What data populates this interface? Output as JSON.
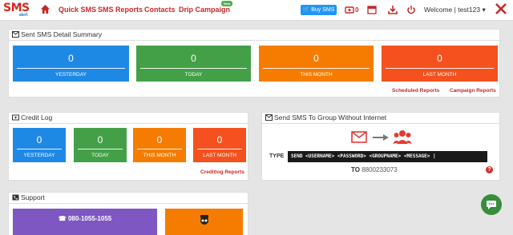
{
  "nav": {
    "logo": "SMS",
    "logo_sub": "alert",
    "quick_sms": "Quick SMS",
    "sms_reports": "SMS Reports",
    "contacts": "Contacts",
    "drip_campaign": "Drip Campaign",
    "new_badge": "New",
    "buy_sms": "Buy SMS",
    "credit_count": "0",
    "welcome": "Welcome | test123 ▾"
  },
  "summary": {
    "title": "Sent SMS Detail Summary",
    "tiles": [
      {
        "value": "0",
        "label": "YESTERDAY",
        "color": "#1e88e5"
      },
      {
        "value": "0",
        "label": "TODAY",
        "color": "#43a047"
      },
      {
        "value": "0",
        "label": "THIS MONTH",
        "color": "#f57c00"
      },
      {
        "value": "0",
        "label": "LAST MONTH",
        "color": "#f4511e"
      }
    ],
    "scheduled_reports": "Scheduled Reports",
    "campaign_reports": "Campaign Reports"
  },
  "credit_log": {
    "title": "Credit Log",
    "tiles": [
      {
        "value": "0",
        "label": "YESTERDAY",
        "color": "#1e88e5"
      },
      {
        "value": "0",
        "label": "TODAY",
        "color": "#43a047"
      },
      {
        "value": "0",
        "label": "THIS MONTH",
        "color": "#f57c00"
      },
      {
        "value": "0",
        "label": "LAST MONTH",
        "color": "#f4511e"
      }
    ],
    "creditlog_reports": "Creditlog Reports"
  },
  "group_sms": {
    "title": "Send SMS To Group Without Internet",
    "type_label": "TYPE",
    "format": "SEND <USERNAME> <PASSWORD> <GROUPNAME> <MESSAGE> |",
    "to_label": "TO",
    "to_number": "8800233073",
    "help": "?"
  },
  "support": {
    "title": "Support",
    "phone": "080-1055-1055",
    "phone_color": "#7e57c2"
  }
}
